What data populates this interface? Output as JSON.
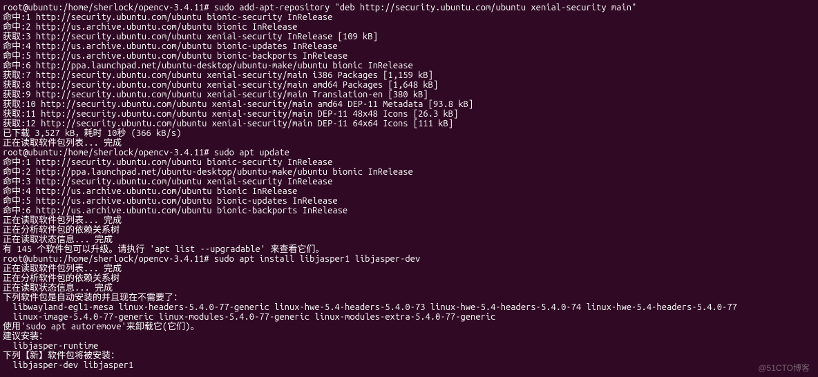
{
  "terminal": {
    "lines": [
      "root@ubuntu:/home/sherlock/opencv-3.4.11# sudo add-apt-repository \"deb http://security.ubuntu.com/ubuntu xenial-security main\"",
      "命中:1 http://security.ubuntu.com/ubuntu bionic-security InRelease",
      "命中:2 http://us.archive.ubuntu.com/ubuntu bionic InRelease",
      "获取:3 http://security.ubuntu.com/ubuntu xenial-security InRelease [109 kB]",
      "命中:4 http://us.archive.ubuntu.com/ubuntu bionic-updates InRelease",
      "命中:5 http://us.archive.ubuntu.com/ubuntu bionic-backports InRelease",
      "命中:6 http://ppa.launchpad.net/ubuntu-desktop/ubuntu-make/ubuntu bionic InRelease",
      "获取:7 http://security.ubuntu.com/ubuntu xenial-security/main i386 Packages [1,159 kB]",
      "获取:8 http://security.ubuntu.com/ubuntu xenial-security/main amd64 Packages [1,648 kB]",
      "获取:9 http://security.ubuntu.com/ubuntu xenial-security/main Translation-en [380 kB]",
      "获取:10 http://security.ubuntu.com/ubuntu xenial-security/main amd64 DEP-11 Metadata [93.8 kB]",
      "获取:11 http://security.ubuntu.com/ubuntu xenial-security/main DEP-11 48x48 Icons [26.3 kB]",
      "获取:12 http://security.ubuntu.com/ubuntu xenial-security/main DEP-11 64x64 Icons [111 kB]",
      "已下载 3,527 kB，耗时 10秒 (366 kB/s)",
      "正在读取软件包列表... 完成",
      "root@ubuntu:/home/sherlock/opencv-3.4.11# sudo apt update",
      "命中:1 http://security.ubuntu.com/ubuntu bionic-security InRelease",
      "命中:2 http://ppa.launchpad.net/ubuntu-desktop/ubuntu-make/ubuntu bionic InRelease",
      "命中:3 http://security.ubuntu.com/ubuntu xenial-security InRelease",
      "命中:4 http://us.archive.ubuntu.com/ubuntu bionic InRelease",
      "命中:5 http://us.archive.ubuntu.com/ubuntu bionic-updates InRelease",
      "命中:6 http://us.archive.ubuntu.com/ubuntu bionic-backports InRelease",
      "正在读取软件包列表... 完成",
      "正在分析软件包的依赖关系树",
      "正在读取状态信息... 完成",
      "有 145 个软件包可以升级。请执行 'apt list --upgradable' 来查看它们。",
      "root@ubuntu:/home/sherlock/opencv-3.4.11# sudo apt install libjasper1 libjasper-dev",
      "正在读取软件包列表... 完成",
      "正在分析软件包的依赖关系树",
      "正在读取状态信息... 完成",
      "下列软件包是自动安装的并且现在不需要了：",
      "  libwayland-egl1-mesa linux-headers-5.4.0-77-generic linux-hwe-5.4-headers-5.4.0-73 linux-hwe-5.4-headers-5.4.0-74 linux-hwe-5.4-headers-5.4.0-77",
      "  linux-image-5.4.0-77-generic linux-modules-5.4.0-77-generic linux-modules-extra-5.4.0-77-generic",
      "使用'sudo apt autoremove'来卸载它(它们)。",
      "建议安装：",
      "  libjasper-runtime",
      "下列【新】软件包将被安装：",
      "  libjasper-dev libjasper1"
    ]
  },
  "watermark": "@51CTO博客"
}
